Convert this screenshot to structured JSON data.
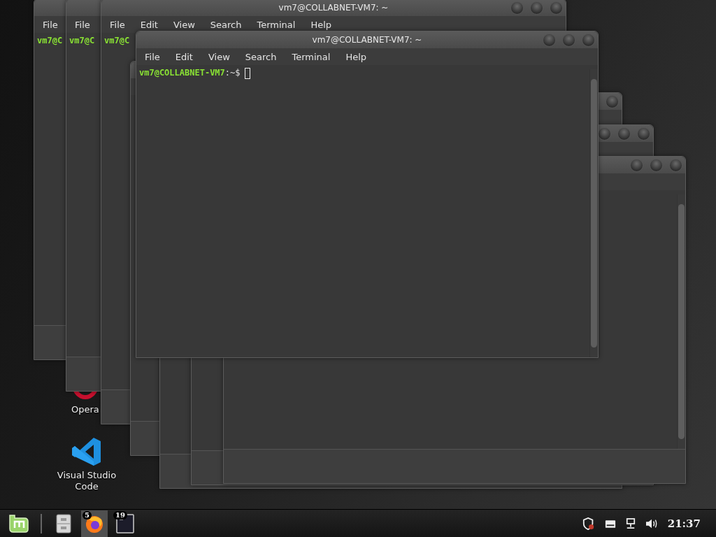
{
  "desktop_icons": [
    {
      "kind": "opera",
      "label": "Opera"
    },
    {
      "kind": "vscode",
      "label": "Visual Studio Code"
    }
  ],
  "background_windows": [
    {
      "kind": "terminal",
      "menu": [
        "File"
      ],
      "prompt": "vm7@C"
    },
    {
      "kind": "terminal",
      "menu": [
        "File"
      ],
      "prompt": "vm7@C"
    },
    {
      "kind": "terminal",
      "title": "vm7@COLLABNET-VM7: ~",
      "menu": [
        "File",
        "Edit",
        "View",
        "Search",
        "Terminal",
        "Help"
      ],
      "prompt": "vm7@C"
    },
    {
      "kind": "terminal"
    },
    {
      "kind": "terminal"
    },
    {
      "kind": "terminal"
    },
    {
      "kind": "terminal"
    }
  ],
  "front_window": {
    "title": "vm7@COLLABNET-VM7: ~",
    "menu": [
      "File",
      "Edit",
      "View",
      "Search",
      "Terminal",
      "Help"
    ],
    "prompt_user": "vm7@COLLABNET-VM7",
    "prompt_path": ":~$"
  },
  "taskbar": {
    "launchers": [
      {
        "kind": "menu",
        "selected": false
      },
      {
        "kind": "files",
        "selected": false
      },
      {
        "kind": "browser",
        "badge": "5",
        "selected": true
      },
      {
        "kind": "terminal",
        "badge": "19",
        "selected": false
      }
    ],
    "clock": "21:37"
  }
}
